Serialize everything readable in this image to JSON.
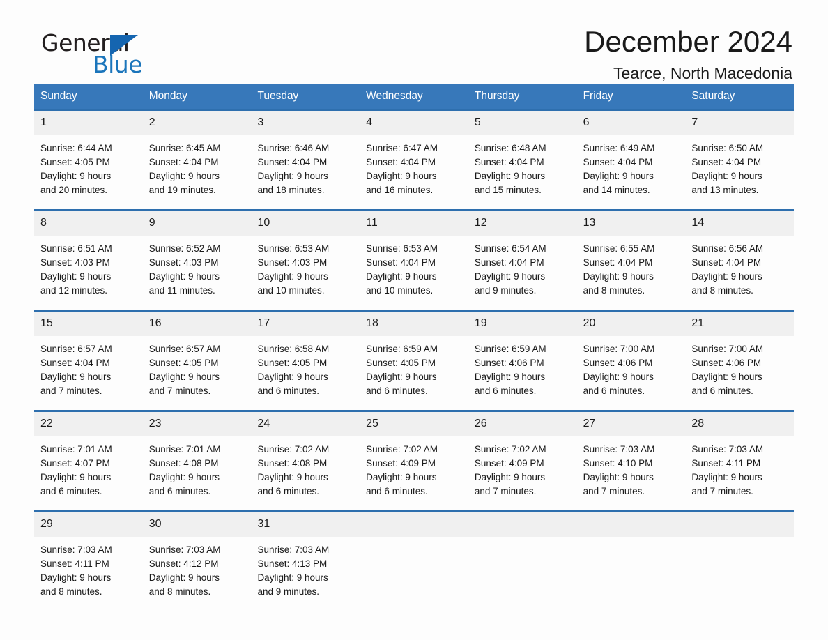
{
  "brand": {
    "name_part1": "General",
    "name_part2": "Blue",
    "triangle_icon": "triangle-right-icon",
    "accent_color": "#1b75bb"
  },
  "header": {
    "title": "December 2024",
    "subtitle": "Tearce, North Macedonia"
  },
  "theme": {
    "header_blue": "#3778ba",
    "rule_blue": "#2e6fae",
    "daynum_band": "#f0f0f0",
    "page_background": "#fdfdfd",
    "text": "#1a1a1a"
  },
  "calendar": {
    "weekday_headers": [
      "Sunday",
      "Monday",
      "Tuesday",
      "Wednesday",
      "Thursday",
      "Friday",
      "Saturday"
    ],
    "weeks": [
      [
        {
          "day": "1",
          "sunrise": "Sunrise: 6:44 AM",
          "sunset": "Sunset: 4:05 PM",
          "daylight_line1": "Daylight: 9 hours",
          "daylight_line2": "and 20 minutes."
        },
        {
          "day": "2",
          "sunrise": "Sunrise: 6:45 AM",
          "sunset": "Sunset: 4:04 PM",
          "daylight_line1": "Daylight: 9 hours",
          "daylight_line2": "and 19 minutes."
        },
        {
          "day": "3",
          "sunrise": "Sunrise: 6:46 AM",
          "sunset": "Sunset: 4:04 PM",
          "daylight_line1": "Daylight: 9 hours",
          "daylight_line2": "and 18 minutes."
        },
        {
          "day": "4",
          "sunrise": "Sunrise: 6:47 AM",
          "sunset": "Sunset: 4:04 PM",
          "daylight_line1": "Daylight: 9 hours",
          "daylight_line2": "and 16 minutes."
        },
        {
          "day": "5",
          "sunrise": "Sunrise: 6:48 AM",
          "sunset": "Sunset: 4:04 PM",
          "daylight_line1": "Daylight: 9 hours",
          "daylight_line2": "and 15 minutes."
        },
        {
          "day": "6",
          "sunrise": "Sunrise: 6:49 AM",
          "sunset": "Sunset: 4:04 PM",
          "daylight_line1": "Daylight: 9 hours",
          "daylight_line2": "and 14 minutes."
        },
        {
          "day": "7",
          "sunrise": "Sunrise: 6:50 AM",
          "sunset": "Sunset: 4:04 PM",
          "daylight_line1": "Daylight: 9 hours",
          "daylight_line2": "and 13 minutes."
        }
      ],
      [
        {
          "day": "8",
          "sunrise": "Sunrise: 6:51 AM",
          "sunset": "Sunset: 4:03 PM",
          "daylight_line1": "Daylight: 9 hours",
          "daylight_line2": "and 12 minutes."
        },
        {
          "day": "9",
          "sunrise": "Sunrise: 6:52 AM",
          "sunset": "Sunset: 4:03 PM",
          "daylight_line1": "Daylight: 9 hours",
          "daylight_line2": "and 11 minutes."
        },
        {
          "day": "10",
          "sunrise": "Sunrise: 6:53 AM",
          "sunset": "Sunset: 4:03 PM",
          "daylight_line1": "Daylight: 9 hours",
          "daylight_line2": "and 10 minutes."
        },
        {
          "day": "11",
          "sunrise": "Sunrise: 6:53 AM",
          "sunset": "Sunset: 4:04 PM",
          "daylight_line1": "Daylight: 9 hours",
          "daylight_line2": "and 10 minutes."
        },
        {
          "day": "12",
          "sunrise": "Sunrise: 6:54 AM",
          "sunset": "Sunset: 4:04 PM",
          "daylight_line1": "Daylight: 9 hours",
          "daylight_line2": "and 9 minutes."
        },
        {
          "day": "13",
          "sunrise": "Sunrise: 6:55 AM",
          "sunset": "Sunset: 4:04 PM",
          "daylight_line1": "Daylight: 9 hours",
          "daylight_line2": "and 8 minutes."
        },
        {
          "day": "14",
          "sunrise": "Sunrise: 6:56 AM",
          "sunset": "Sunset: 4:04 PM",
          "daylight_line1": "Daylight: 9 hours",
          "daylight_line2": "and 8 minutes."
        }
      ],
      [
        {
          "day": "15",
          "sunrise": "Sunrise: 6:57 AM",
          "sunset": "Sunset: 4:04 PM",
          "daylight_line1": "Daylight: 9 hours",
          "daylight_line2": "and 7 minutes."
        },
        {
          "day": "16",
          "sunrise": "Sunrise: 6:57 AM",
          "sunset": "Sunset: 4:05 PM",
          "daylight_line1": "Daylight: 9 hours",
          "daylight_line2": "and 7 minutes."
        },
        {
          "day": "17",
          "sunrise": "Sunrise: 6:58 AM",
          "sunset": "Sunset: 4:05 PM",
          "daylight_line1": "Daylight: 9 hours",
          "daylight_line2": "and 6 minutes."
        },
        {
          "day": "18",
          "sunrise": "Sunrise: 6:59 AM",
          "sunset": "Sunset: 4:05 PM",
          "daylight_line1": "Daylight: 9 hours",
          "daylight_line2": "and 6 minutes."
        },
        {
          "day": "19",
          "sunrise": "Sunrise: 6:59 AM",
          "sunset": "Sunset: 4:06 PM",
          "daylight_line1": "Daylight: 9 hours",
          "daylight_line2": "and 6 minutes."
        },
        {
          "day": "20",
          "sunrise": "Sunrise: 7:00 AM",
          "sunset": "Sunset: 4:06 PM",
          "daylight_line1": "Daylight: 9 hours",
          "daylight_line2": "and 6 minutes."
        },
        {
          "day": "21",
          "sunrise": "Sunrise: 7:00 AM",
          "sunset": "Sunset: 4:06 PM",
          "daylight_line1": "Daylight: 9 hours",
          "daylight_line2": "and 6 minutes."
        }
      ],
      [
        {
          "day": "22",
          "sunrise": "Sunrise: 7:01 AM",
          "sunset": "Sunset: 4:07 PM",
          "daylight_line1": "Daylight: 9 hours",
          "daylight_line2": "and 6 minutes."
        },
        {
          "day": "23",
          "sunrise": "Sunrise: 7:01 AM",
          "sunset": "Sunset: 4:08 PM",
          "daylight_line1": "Daylight: 9 hours",
          "daylight_line2": "and 6 minutes."
        },
        {
          "day": "24",
          "sunrise": "Sunrise: 7:02 AM",
          "sunset": "Sunset: 4:08 PM",
          "daylight_line1": "Daylight: 9 hours",
          "daylight_line2": "and 6 minutes."
        },
        {
          "day": "25",
          "sunrise": "Sunrise: 7:02 AM",
          "sunset": "Sunset: 4:09 PM",
          "daylight_line1": "Daylight: 9 hours",
          "daylight_line2": "and 6 minutes."
        },
        {
          "day": "26",
          "sunrise": "Sunrise: 7:02 AM",
          "sunset": "Sunset: 4:09 PM",
          "daylight_line1": "Daylight: 9 hours",
          "daylight_line2": "and 7 minutes."
        },
        {
          "day": "27",
          "sunrise": "Sunrise: 7:03 AM",
          "sunset": "Sunset: 4:10 PM",
          "daylight_line1": "Daylight: 9 hours",
          "daylight_line2": "and 7 minutes."
        },
        {
          "day": "28",
          "sunrise": "Sunrise: 7:03 AM",
          "sunset": "Sunset: 4:11 PM",
          "daylight_line1": "Daylight: 9 hours",
          "daylight_line2": "and 7 minutes."
        }
      ],
      [
        {
          "day": "29",
          "sunrise": "Sunrise: 7:03 AM",
          "sunset": "Sunset: 4:11 PM",
          "daylight_line1": "Daylight: 9 hours",
          "daylight_line2": "and 8 minutes."
        },
        {
          "day": "30",
          "sunrise": "Sunrise: 7:03 AM",
          "sunset": "Sunset: 4:12 PM",
          "daylight_line1": "Daylight: 9 hours",
          "daylight_line2": "and 8 minutes."
        },
        {
          "day": "31",
          "sunrise": "Sunrise: 7:03 AM",
          "sunset": "Sunset: 4:13 PM",
          "daylight_line1": "Daylight: 9 hours",
          "daylight_line2": "and 9 minutes."
        },
        {
          "day": "",
          "sunrise": "",
          "sunset": "",
          "daylight_line1": "",
          "daylight_line2": ""
        },
        {
          "day": "",
          "sunrise": "",
          "sunset": "",
          "daylight_line1": "",
          "daylight_line2": ""
        },
        {
          "day": "",
          "sunrise": "",
          "sunset": "",
          "daylight_line1": "",
          "daylight_line2": ""
        },
        {
          "day": "",
          "sunrise": "",
          "sunset": "",
          "daylight_line1": "",
          "daylight_line2": ""
        }
      ]
    ]
  }
}
